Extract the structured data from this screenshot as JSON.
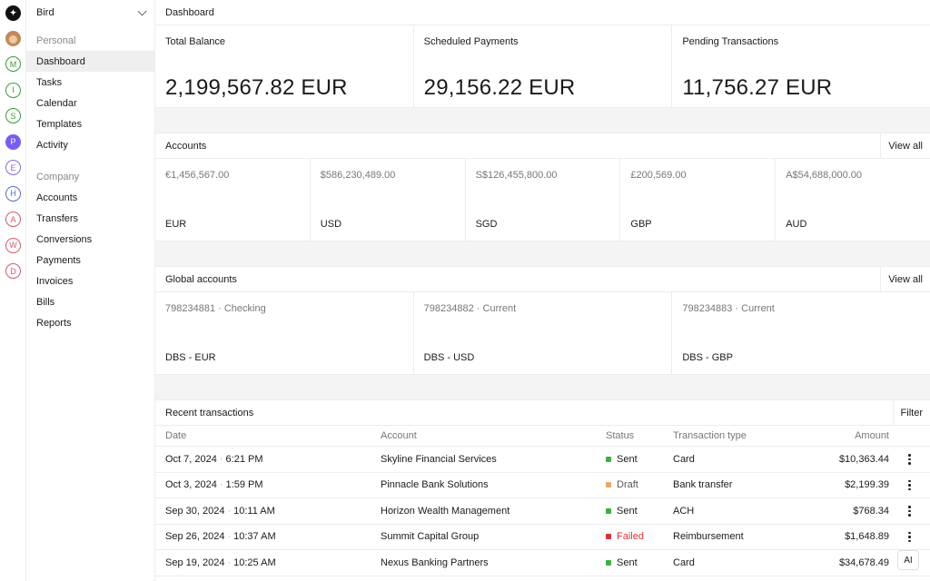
{
  "rail": {
    "items": [
      {
        "letter": "M",
        "color": "#3a9a3a"
      },
      {
        "letter": "I",
        "color": "#3a9a3a"
      },
      {
        "letter": "S",
        "color": "#3a9a3a"
      },
      {
        "letter": "P",
        "color": "#7a5cf0",
        "filled": true
      },
      {
        "letter": "E",
        "color": "#8a6ad0"
      },
      {
        "letter": "H",
        "color": "#5a6ad0"
      },
      {
        "letter": "A",
        "color": "#d05a6a"
      },
      {
        "letter": "W",
        "color": "#d05a6a"
      },
      {
        "letter": "D",
        "color": "#d05a6a"
      }
    ]
  },
  "sidebar": {
    "workspace": "Bird",
    "personal_label": "Personal",
    "personal_items": [
      "Dashboard",
      "Tasks",
      "Calendar",
      "Templates",
      "Activity"
    ],
    "company_label": "Company",
    "company_items": [
      "Accounts",
      "Transfers",
      "Conversions",
      "Payments",
      "Invoices",
      "Bills",
      "Reports"
    ]
  },
  "topbar": {
    "title": "Dashboard"
  },
  "stats": [
    {
      "label": "Total Balance",
      "value": "2,199,567.82 EUR"
    },
    {
      "label": "Scheduled Payments",
      "value": "29,156.22 EUR"
    },
    {
      "label": "Pending Transactions",
      "value": "11,756.27 EUR"
    }
  ],
  "accounts": {
    "title": "Accounts",
    "action": "View all",
    "items": [
      {
        "amount": "€1,456,567.00",
        "currency": "EUR"
      },
      {
        "amount": "$586,230,489.00",
        "currency": "USD"
      },
      {
        "amount": "S$126,455,800.00",
        "currency": "SGD"
      },
      {
        "amount": "£200,569.00",
        "currency": "GBP"
      },
      {
        "amount": "A$54,688,000.00",
        "currency": "AUD"
      }
    ]
  },
  "global_accounts": {
    "title": "Global accounts",
    "action": "View all",
    "items": [
      {
        "number": "798234881 · Checking",
        "name": "DBS - EUR"
      },
      {
        "number": "798234882 · Current",
        "name": "DBS - USD"
      },
      {
        "number": "798234883 · Current",
        "name": "DBS - GBP"
      }
    ]
  },
  "transactions": {
    "title": "Recent transactions",
    "action": "Filter",
    "columns": {
      "date": "Date",
      "account": "Account",
      "status": "Status",
      "type": "Transaction type",
      "amount": "Amount"
    },
    "rows": [
      {
        "date": "Oct 7, 2024",
        "time": "6:21 PM",
        "account": "Skyline Financial Services",
        "status": "Sent",
        "status_color": "#3cb043",
        "text_color": "#1a1a1a",
        "type": "Card",
        "amount": "$10,363.44"
      },
      {
        "date": "Oct 3, 2024",
        "time": "1:59 PM",
        "account": "Pinnacle Bank Solutions",
        "status": "Draft",
        "status_color": "#e8a860",
        "text_color": "#555555",
        "type": "Bank transfer",
        "amount": "$2,199.39"
      },
      {
        "date": "Sep 30, 2024",
        "time": "10:11 AM",
        "account": "Horizon Wealth Management",
        "status": "Sent",
        "status_color": "#3cb043",
        "text_color": "#1a1a1a",
        "type": "ACH",
        "amount": "$768.34"
      },
      {
        "date": "Sep 26, 2024",
        "time": "10:37 AM",
        "account": "Summit Capital Group",
        "status": "Failed",
        "status_color": "#e03030",
        "text_color": "#e03030",
        "type": "Reimbursement",
        "amount": "$1,648.89"
      },
      {
        "date": "Sep 19, 2024",
        "time": "10:25 AM",
        "account": "Nexus Banking Partners",
        "status": "Sent",
        "status_color": "#3cb043",
        "text_color": "#1a1a1a",
        "type": "Card",
        "amount": "$34,678.49"
      }
    ]
  },
  "ai_badge": "AI"
}
